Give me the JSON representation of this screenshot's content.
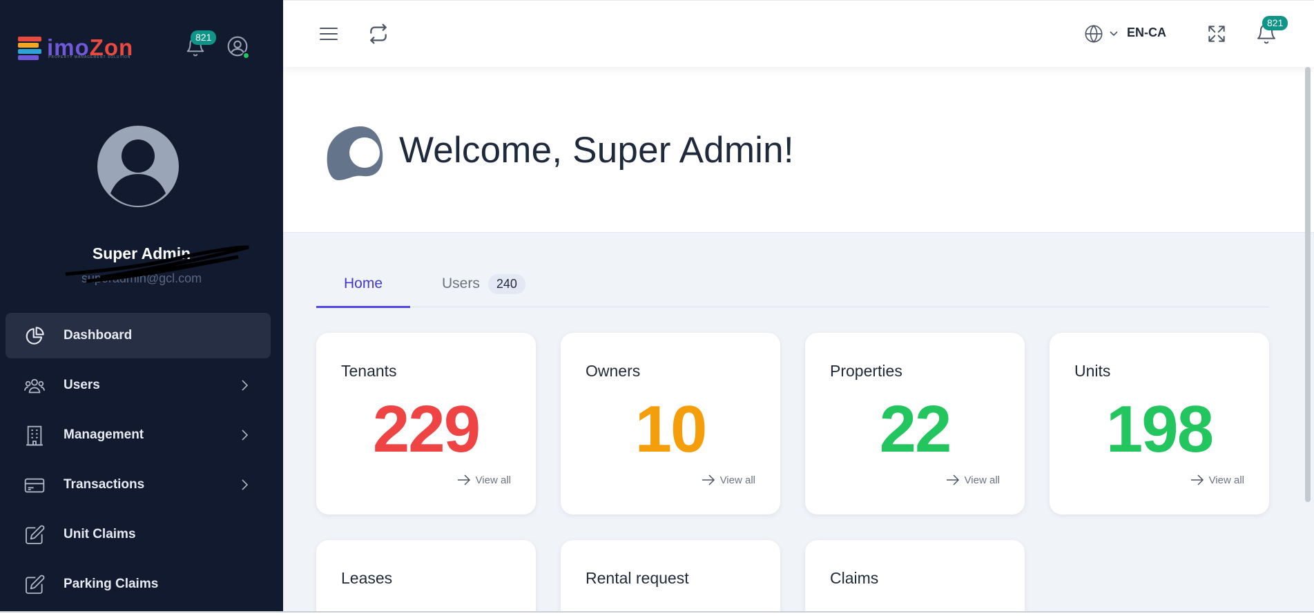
{
  "brand": {
    "logo_text_a": "imo",
    "logo_text_b": "Zon",
    "logo_tagline": "PROPERTY MANAGEMENT SOLUTION"
  },
  "sidebar": {
    "notifications_count": "821",
    "profile": {
      "name": "Super Admin",
      "email": "superadmin@gcl.com"
    },
    "items": [
      {
        "label": "Dashboard",
        "icon": "pie-chart-icon",
        "active": true,
        "has_submenu": false
      },
      {
        "label": "Users",
        "icon": "users-icon",
        "active": false,
        "has_submenu": true
      },
      {
        "label": "Management",
        "icon": "building-icon",
        "active": false,
        "has_submenu": true
      },
      {
        "label": "Transactions",
        "icon": "credit-card-icon",
        "active": false,
        "has_submenu": true
      },
      {
        "label": "Unit Claims",
        "icon": "edit-icon",
        "active": false,
        "has_submenu": false
      },
      {
        "label": "Parking Claims",
        "icon": "edit-icon",
        "active": false,
        "has_submenu": false
      }
    ]
  },
  "topbar": {
    "language": "EN-CA",
    "notifications_count": "821"
  },
  "welcome": {
    "title": "Welcome, Super Admin!"
  },
  "tabs": [
    {
      "label": "Home",
      "active": true
    },
    {
      "label": "Users",
      "count": "240",
      "active": false
    }
  ],
  "stats": [
    {
      "title": "Tenants",
      "value": "229",
      "color": "#ef4444",
      "link": "View all"
    },
    {
      "title": "Owners",
      "value": "10",
      "color": "#f59e0b",
      "link": "View all"
    },
    {
      "title": "Properties",
      "value": "22",
      "color": "#22c55e",
      "link": "View all"
    },
    {
      "title": "Units",
      "value": "198",
      "color": "#22c55e",
      "link": "View all"
    }
  ],
  "stats_row2": [
    {
      "title": "Leases"
    },
    {
      "title": "Rental request"
    },
    {
      "title": "Claims"
    }
  ],
  "colors": {
    "sidebar_bg": "#111a2e",
    "accent": "#4f46e5",
    "badge": "#0f9488"
  }
}
